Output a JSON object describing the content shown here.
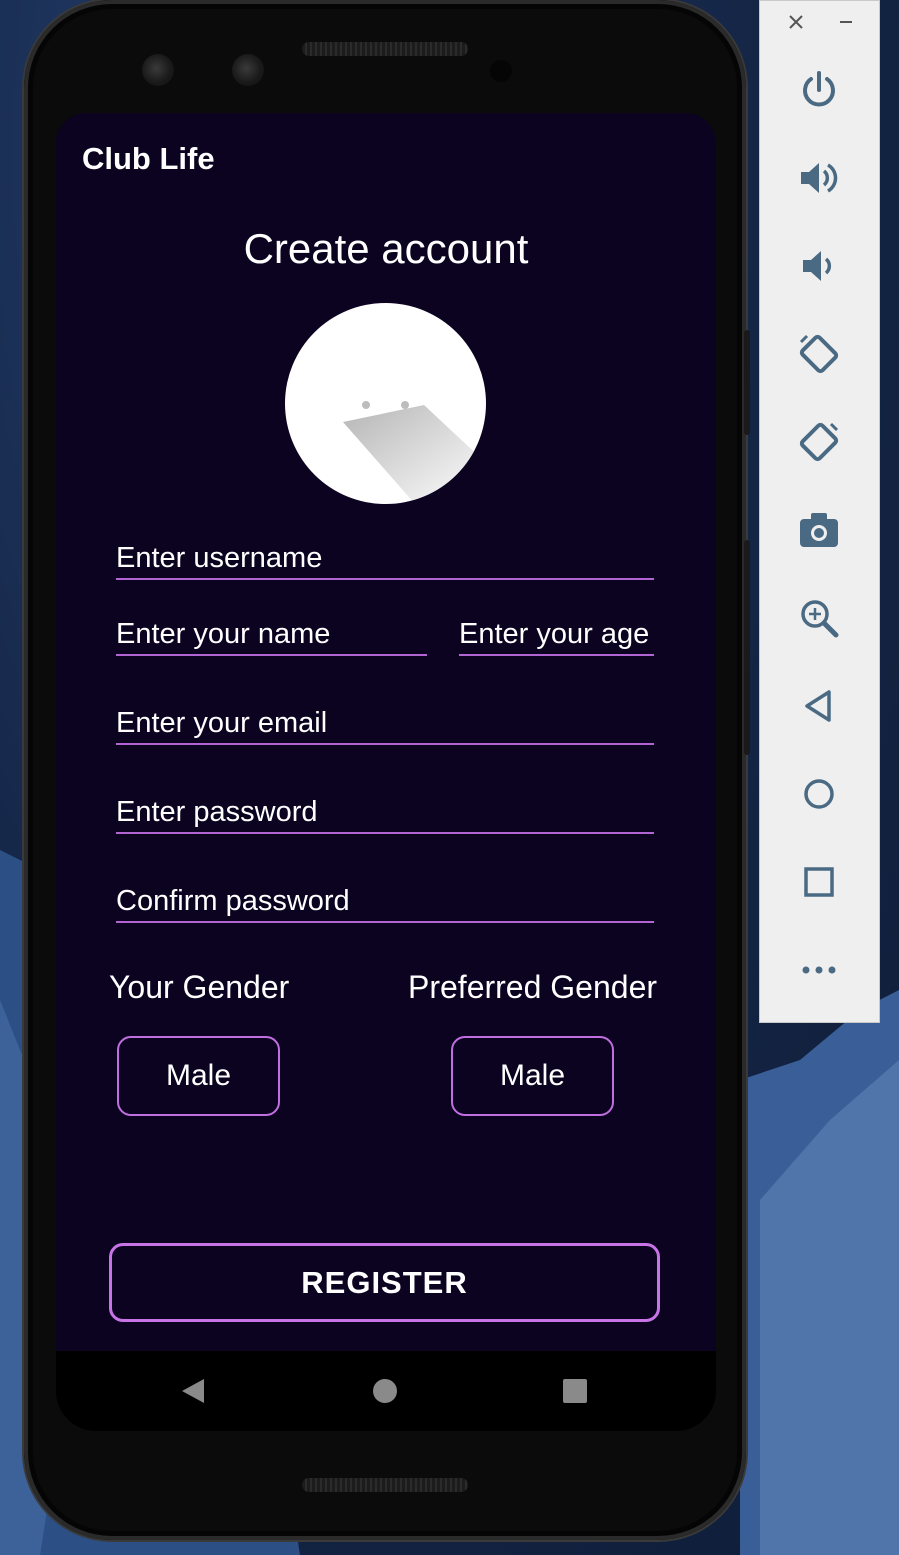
{
  "app": {
    "title": "Club Life"
  },
  "page": {
    "title": "Create account"
  },
  "form": {
    "username_placeholder": "Enter username",
    "name_placeholder": "Enter your name",
    "age_placeholder": "Enter your age",
    "email_placeholder": "Enter your email",
    "password_placeholder": "Enter password",
    "confirm_placeholder": "Confirm password"
  },
  "gender": {
    "your_label": "Your Gender",
    "your_value": "Male",
    "preferred_label": "Preferred Gender",
    "preferred_value": "Male"
  },
  "register_label": "REGISTER",
  "system_nav": {
    "icons": [
      "back-icon",
      "home-icon",
      "recents-icon"
    ]
  },
  "emulator_toolbar": {
    "window_icons": [
      "close-icon",
      "minimize-icon"
    ],
    "icons": [
      "power-icon",
      "volume-up-icon",
      "volume-down-icon",
      "rotate-left-icon",
      "rotate-right-icon",
      "camera-icon",
      "zoom-icon",
      "back-icon",
      "home-icon",
      "overview-icon",
      "more-icon"
    ]
  },
  "colors": {
    "screen_bg": "#0c0321",
    "accent": "#c06ee0",
    "toolbar_bg": "#efefef",
    "toolbar_icon": "#4a6a84"
  }
}
